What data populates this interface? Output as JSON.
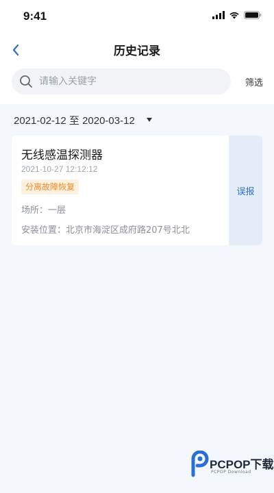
{
  "status_bar": {
    "time": "9:41"
  },
  "nav": {
    "title": "历史记录",
    "back_icon": "chevron-left-icon"
  },
  "search": {
    "placeholder": "请输入关键字",
    "value": "",
    "filter_label": "筛选"
  },
  "date_range": {
    "text": "2021-02-12 至 2020-03-12"
  },
  "records": [
    {
      "title": "无线感温探测器",
      "time": "2021-10-27 12:12:12",
      "status": "分离故障恢复",
      "location": "场所：一层",
      "address": "安装位置：北京市海淀区成府路207号北北",
      "action_label": "误报"
    }
  ],
  "watermark": {
    "text": "PCPOP下载",
    "sub": "PCPOP Download"
  },
  "colors": {
    "accent": "#2b6fd6",
    "badge_text": "#f08a24",
    "badge_bg": "#fff1e0",
    "page_bg": "#f4f7fb"
  }
}
